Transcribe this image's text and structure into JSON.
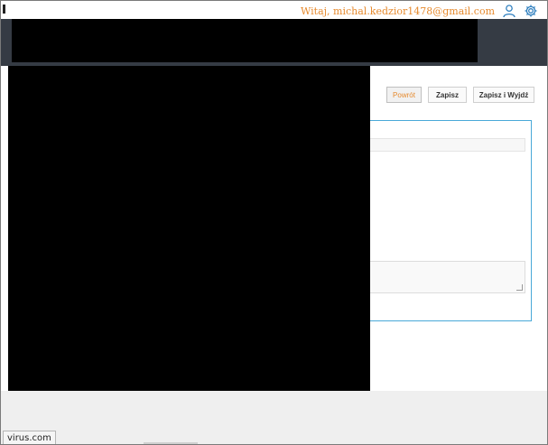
{
  "header": {
    "welcome_text": "Witaj, michal.kedzior1478@gmail.com",
    "icons": [
      "user-icon",
      "gear-icon"
    ],
    "accent_color": "#e68a2e",
    "header_color": "#353b44"
  },
  "toolbar": {
    "back_label": "Powrót",
    "save_label": "Zapisz",
    "save_exit_label": "Zapisz i Wyjdź"
  },
  "form": {
    "panel_border_color": "#49a9d8"
  },
  "status_bar": {
    "url_text": "virus.com"
  }
}
